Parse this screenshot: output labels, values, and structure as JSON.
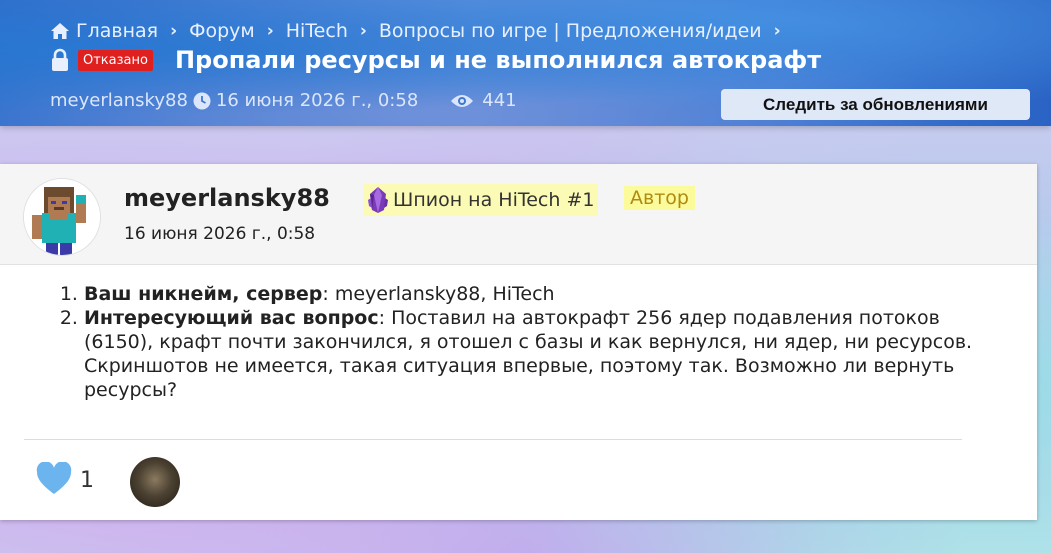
{
  "breadcrumb": [
    {
      "label": "Главная"
    },
    {
      "label": "Форум"
    },
    {
      "label": "HiTech"
    },
    {
      "label": "Вопросы по игре | Предложения/идеи"
    }
  ],
  "thread": {
    "status": "Отказано",
    "title": "Пропали ресурсы и не выполнился автокрафт",
    "author": "meyerlansky88",
    "date": "16 июня 2026 г., 0:58",
    "views": "441",
    "follow_label": "Следить за обновлениями"
  },
  "post": {
    "username": "meyerlansky88",
    "date": "16 июня 2026 г., 0:58",
    "rank": "Шпион на HiTech #1",
    "author_badge": "Автор",
    "items": [
      {
        "label": "Ваш никнейм, сервер",
        "text": ": meyerlansky88, HiTech"
      },
      {
        "label": "Интересующий вас вопрос",
        "text": ": Поставил на автокрафт 256 ядер подавления потоков (6150), крафт почти закончился, я отошел с базы и как вернулся, ни ядер, ни ресурсов. Скриншотов не имеется, такая ситуация впервые, поэтому так. Возможно ли вернуть ресурсы?"
      }
    ],
    "likes": "1"
  },
  "colors": {
    "header": "#3f78d2",
    "status_badge": "#e01f1f",
    "rank_badge": "#fbfbb5",
    "like_heart": "#6cb4ee"
  },
  "icons": [
    "home-icon",
    "chevron-right-icon",
    "lock-icon",
    "clock-icon",
    "eye-icon",
    "gem-icon",
    "heart-icon"
  ]
}
